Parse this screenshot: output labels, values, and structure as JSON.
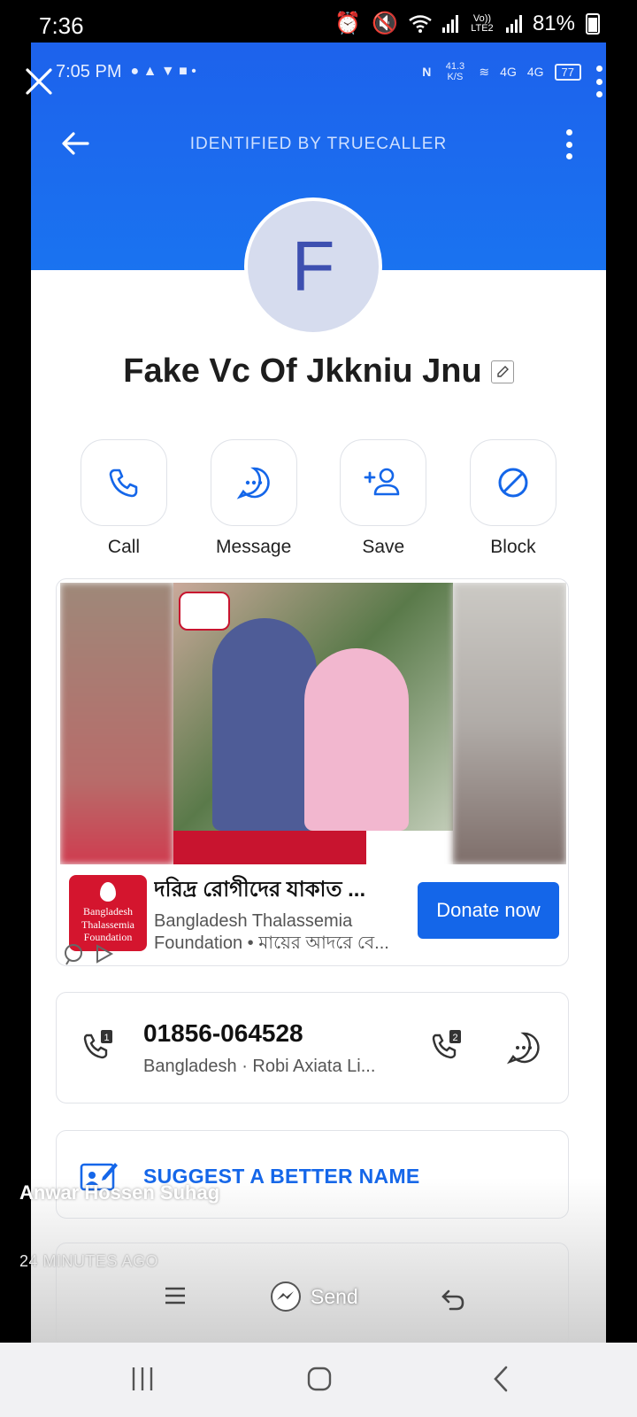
{
  "outer_status": {
    "time": "7:36",
    "battery": "81%",
    "network": "Vo)) LTE2"
  },
  "inner_status": {
    "time": "7:05 PM",
    "speed": "41.3 K/S",
    "net1": "4G",
    "net2": "4G",
    "battery": "77"
  },
  "appbar": {
    "title": "IDENTIFIED BY TRUECALLER"
  },
  "contact": {
    "avatar_letter": "F",
    "name": "Fake Vc Of Jkkniu Jnu"
  },
  "actions": [
    {
      "label": "Call"
    },
    {
      "label": "Message"
    },
    {
      "label": "Save"
    },
    {
      "label": "Block"
    }
  ],
  "ad": {
    "title": "দরিদ্র রোগীদের যাকাত ...",
    "subtitle": "Bangladesh Thalassemia Foundation • মায়ের আদরে বে...",
    "cta": "Donate now",
    "logo_text_1": "Bangladesh",
    "logo_text_2": "Thalassemia",
    "logo_text_3": "Foundation"
  },
  "number_card": {
    "number": "01856-064528",
    "carrier": "Bangladesh · Robi Axiata Li...",
    "sim1": "1",
    "sim2": "2"
  },
  "suggest": {
    "label": "SUGGEST A BETTER NAME"
  },
  "story": {
    "sender": "Anwar Hossen Suhag",
    "time_ago": "24 MINUTES AGO",
    "send_label": "Send"
  },
  "colors": {
    "truecaller_blue": "#1a6cef",
    "cta_blue": "#1466e9",
    "ad_red": "#d4152e"
  }
}
